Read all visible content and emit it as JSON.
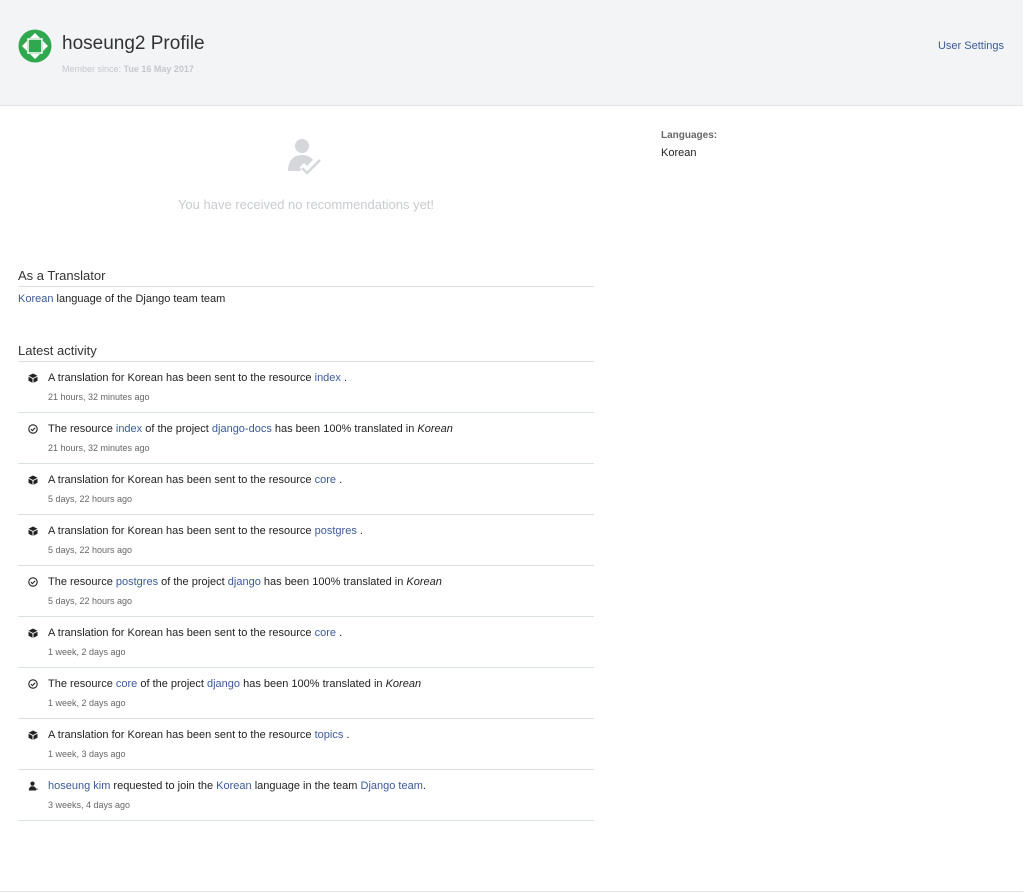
{
  "header": {
    "title": "hoseung2 Profile",
    "member_label": "Member since:",
    "member_date": "Tue 16 May 2017",
    "settings_link": "User Settings",
    "avatar_color": "#2fa84f"
  },
  "recommendations": {
    "empty_text": "You have received no recommendations yet!"
  },
  "translator": {
    "heading": "As a Translator",
    "language_link": "Korean",
    "rest": "language of the Django team team"
  },
  "activity": {
    "heading": "Latest activity",
    "items": [
      {
        "icon": "box-icon",
        "parts": [
          "A translation for Korean has been sent to the resource ",
          "index",
          " ."
        ],
        "time": "21 hours, 32 minutes ago"
      },
      {
        "icon": "check-circle-icon",
        "parts": [
          "The resource ",
          "index",
          " of the project ",
          "django-docs",
          " has been 100% translated in ",
          "Korean"
        ],
        "time": "21 hours, 32 minutes ago"
      },
      {
        "icon": "box-icon",
        "parts": [
          "A translation for Korean has been sent to the resource ",
          "core",
          " ."
        ],
        "time": "5 days, 22 hours ago"
      },
      {
        "icon": "box-icon",
        "parts": [
          "A translation for Korean has been sent to the resource ",
          "postgres",
          " ."
        ],
        "time": "5 days, 22 hours ago"
      },
      {
        "icon": "check-circle-icon",
        "parts": [
          "The resource ",
          "postgres",
          " of the project ",
          "django",
          " has been 100% translated in ",
          "Korean"
        ],
        "time": "5 days, 22 hours ago"
      },
      {
        "icon": "box-icon",
        "parts": [
          "A translation for Korean has been sent to the resource ",
          "core",
          " ."
        ],
        "time": "1 week, 2 days ago"
      },
      {
        "icon": "check-circle-icon",
        "parts": [
          "The resource ",
          "core",
          " of the project ",
          "django",
          " has been 100% translated in ",
          "Korean"
        ],
        "time": "1 week, 2 days ago"
      },
      {
        "icon": "box-icon",
        "parts": [
          "A translation for Korean has been sent to the resource ",
          "topics",
          " ."
        ],
        "time": "1 week, 3 days ago"
      },
      {
        "icon": "user-icon",
        "parts": [
          "hoseung kim",
          " requested to join the ",
          "Korean",
          " language in the team ",
          "Django team",
          "."
        ],
        "time": "3 weeks, 4 days ago"
      }
    ]
  },
  "sidebar": {
    "languages_label": "Languages:",
    "languages_value": "Korean"
  }
}
